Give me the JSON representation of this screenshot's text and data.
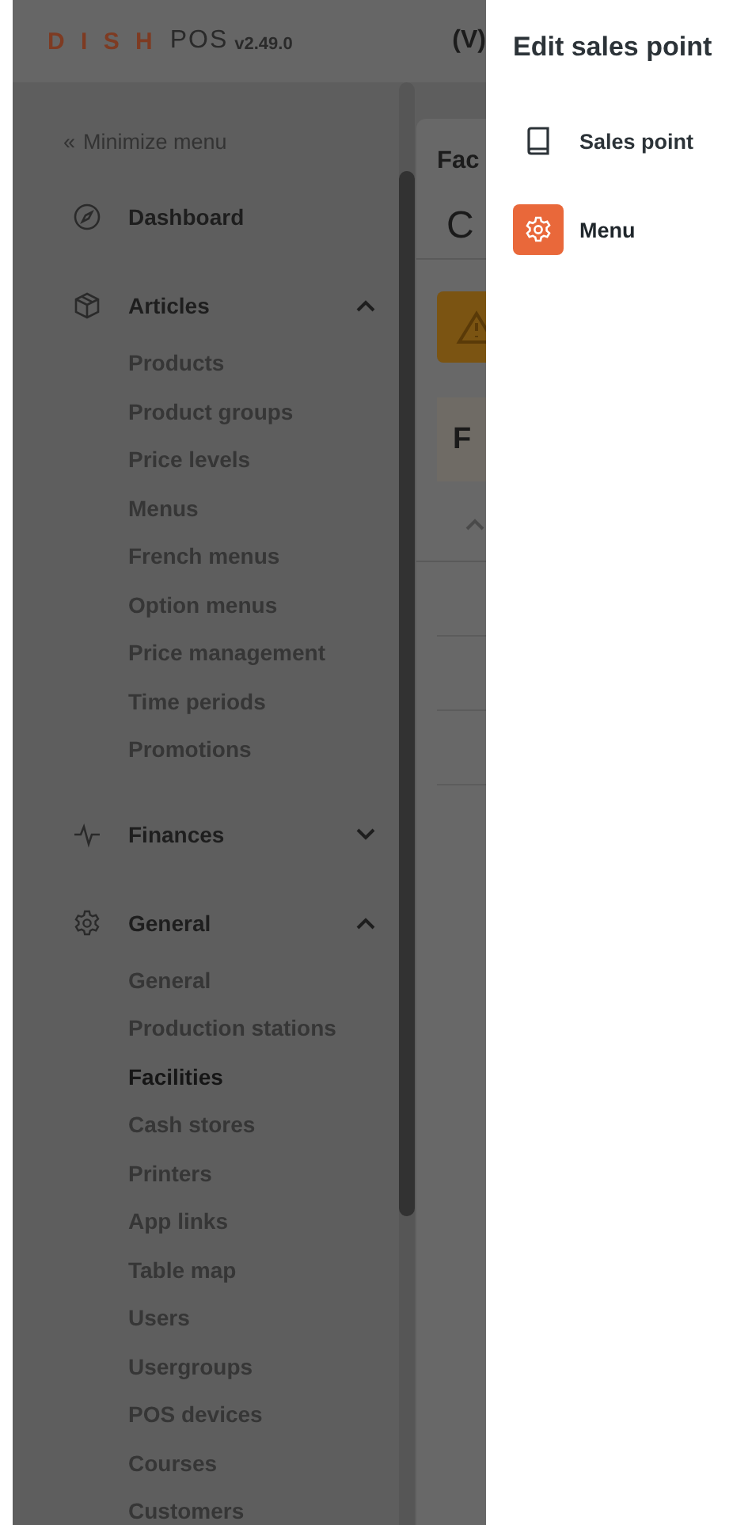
{
  "header": {
    "logo": "D I S H",
    "product": "POS",
    "version": "v2.49.0",
    "title_fragment": "(V)"
  },
  "sidebar": {
    "minimize": {
      "icon": "«",
      "label": "Minimize menu"
    },
    "groups": [
      {
        "label": "Dashboard"
      },
      {
        "label": "Articles",
        "expanded": true,
        "children": [
          {
            "label": "Products",
            "selected": false
          },
          {
            "label": "Product groups",
            "selected": false
          },
          {
            "label": "Price levels",
            "selected": false
          },
          {
            "label": "Menus",
            "selected": false
          },
          {
            "label": "French menus",
            "selected": false
          },
          {
            "label": "Option menus",
            "selected": false
          },
          {
            "label": "Price management",
            "selected": false
          },
          {
            "label": "Time periods",
            "selected": false
          },
          {
            "label": "Promotions",
            "selected": false
          }
        ]
      },
      {
        "label": "Finances",
        "expanded": false
      },
      {
        "label": "General",
        "expanded": true,
        "children": [
          {
            "label": "General",
            "selected": false
          },
          {
            "label": "Production stations",
            "selected": false
          },
          {
            "label": "Facilities",
            "selected": true
          },
          {
            "label": "Cash stores",
            "selected": false
          },
          {
            "label": "Printers",
            "selected": false
          },
          {
            "label": "App links",
            "selected": false
          },
          {
            "label": "Table map",
            "selected": false
          },
          {
            "label": "Users",
            "selected": false
          },
          {
            "label": "Usergroups",
            "selected": false
          },
          {
            "label": "POS devices",
            "selected": false
          },
          {
            "label": "Courses",
            "selected": false
          },
          {
            "label": "Customers",
            "selected": false
          }
        ]
      }
    ]
  },
  "main": {
    "title": "Fac",
    "heading": "C",
    "section": "F"
  },
  "panel": {
    "title": "Edit sales point",
    "items": [
      {
        "label": "Sales point",
        "selected": false
      },
      {
        "label": "Menu",
        "selected": true
      }
    ]
  }
}
